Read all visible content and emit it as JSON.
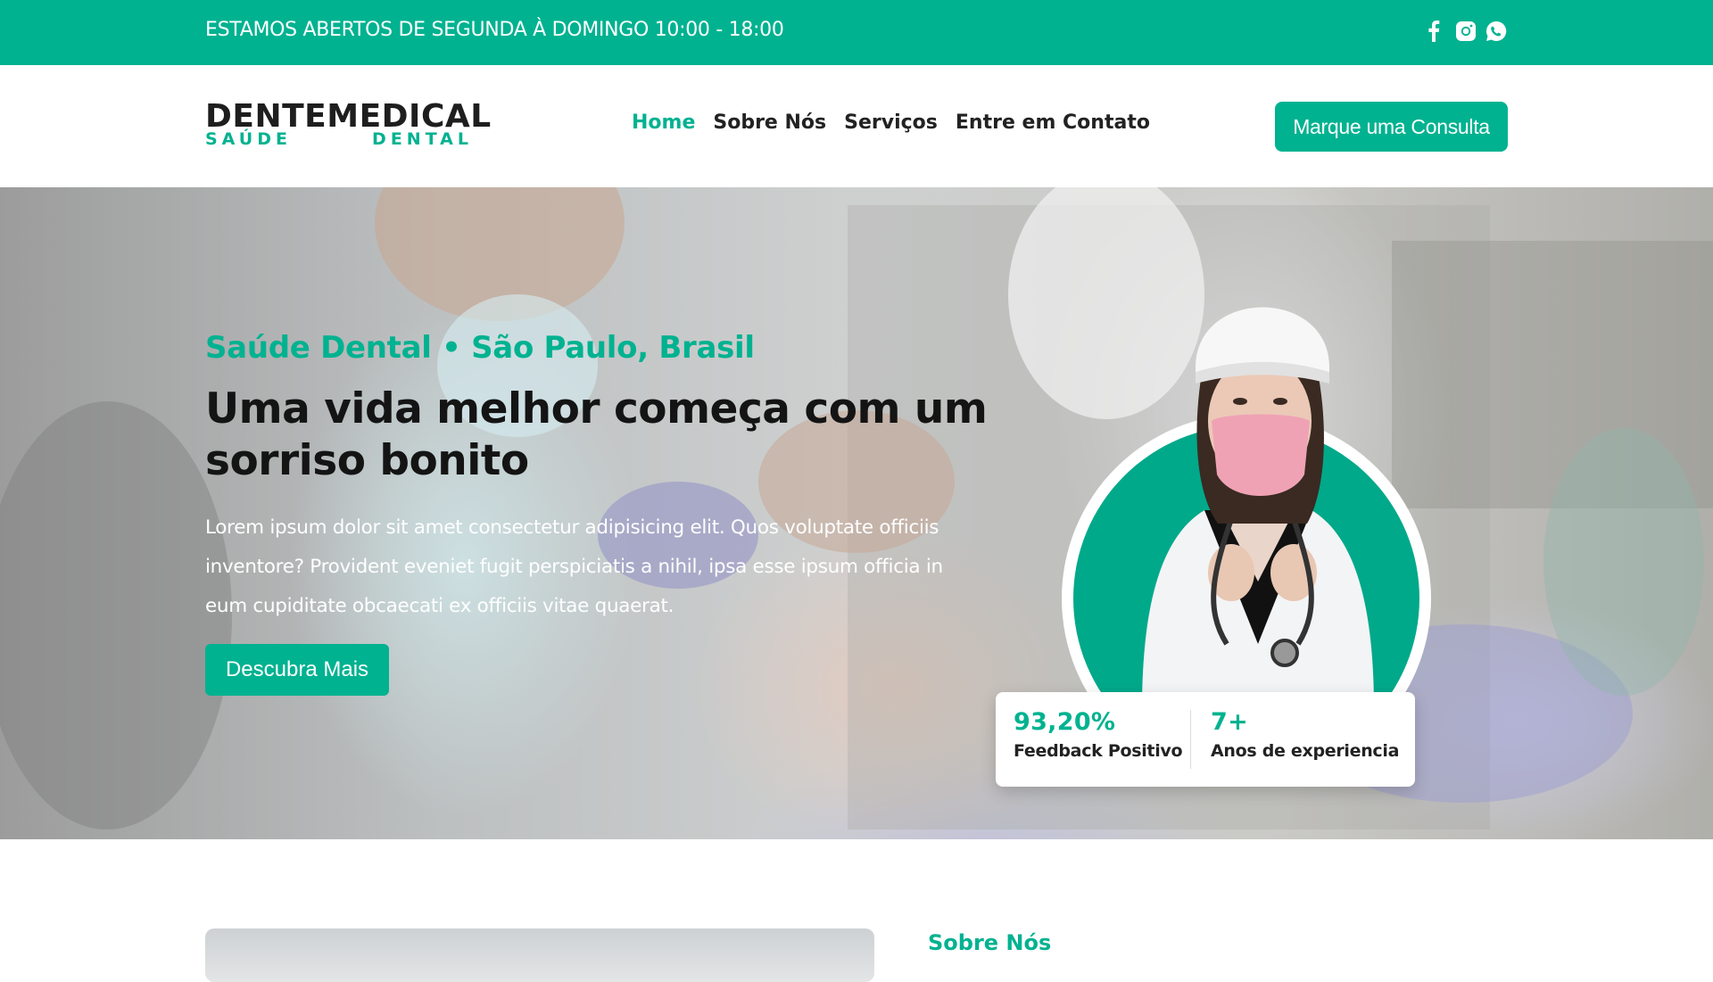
{
  "colors": {
    "accent": "#00b290",
    "dark": "#1e1e1e",
    "white": "#ffffff"
  },
  "topbar": {
    "hours": "ESTAMOS ABERTOS DE SEGUNDA À DOMINGO 10:00 - 18:00",
    "social_icons": [
      "facebook-icon",
      "instagram-icon",
      "whatsapp-icon"
    ]
  },
  "header": {
    "logo_main": "DENTEMEDICAL",
    "logo_sub_left": "SAÚDE",
    "logo_sub_right": "DENTAL",
    "nav": [
      {
        "label": "Home"
      },
      {
        "label": "Sobre Nós"
      },
      {
        "label": "Serviços"
      },
      {
        "label": "Entre em Contato"
      }
    ],
    "cta_label": "Marque uma Consulta"
  },
  "hero": {
    "eyebrow": "Saúde Dental • São Paulo, Brasil",
    "title": "Uma vida melhor começa com um sorriso bonito",
    "text": "Lorem ipsum dolor sit amet consectetur adipisicing elit. Quos voluptate officiis inventore? Provident eveniet fugit perspiciatis a nihil, ipsa esse ipsum officia in eum cupiditate obcaecati ex officiis vitae quaerat.",
    "button_label": "Descubra Mais",
    "stats": [
      {
        "value": "93,20%",
        "label": "Feedback Positivo"
      },
      {
        "value": "7+",
        "label": "Anos de experiencia"
      }
    ]
  },
  "about": {
    "title": "Sobre Nós"
  }
}
